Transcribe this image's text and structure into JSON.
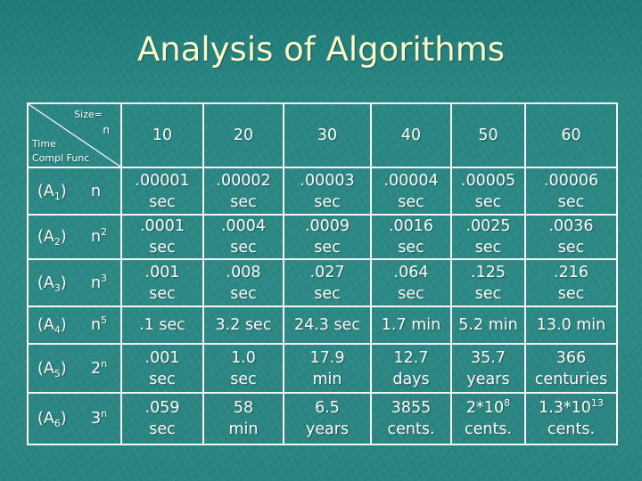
{
  "title": "Analysis of Algorithms",
  "corner": {
    "size_label": "Size=",
    "n_label": "n",
    "time_label": "Time",
    "func_label": "Compl Func"
  },
  "sizes": [
    "10",
    "20",
    "30",
    "40",
    "50",
    "60"
  ],
  "rows": [
    {
      "alg": "(A",
      "sub": "1",
      "alg_close": ")",
      "func_base": "n",
      "func_exp": "",
      "cells": [
        [
          ".00001",
          "sec"
        ],
        [
          ".00002",
          "sec"
        ],
        [
          ".00003",
          "sec"
        ],
        [
          ".00004",
          "sec"
        ],
        [
          ".00005",
          "sec"
        ],
        [
          ".00006",
          "sec"
        ]
      ]
    },
    {
      "alg": "(A",
      "sub": "2",
      "alg_close": ")",
      "func_base": "n",
      "func_exp": "2",
      "cells": [
        [
          ".0001",
          "sec"
        ],
        [
          ".0004",
          "sec"
        ],
        [
          ".0009",
          "sec"
        ],
        [
          ".0016",
          "sec"
        ],
        [
          ".0025",
          "sec"
        ],
        [
          ".0036",
          "sec"
        ]
      ]
    },
    {
      "alg": "(A",
      "sub": "3",
      "alg_close": ")",
      "func_base": "n",
      "func_exp": "3",
      "cells": [
        [
          ".001",
          "sec"
        ],
        [
          ".008",
          "sec"
        ],
        [
          ".027",
          "sec"
        ],
        [
          ".064",
          "sec"
        ],
        [
          ".125",
          "sec"
        ],
        [
          ".216",
          "sec"
        ]
      ]
    },
    {
      "alg": "(A",
      "sub": "4",
      "alg_close": ")",
      "func_base": "n",
      "func_exp": "5",
      "cells": [
        [
          ".1 sec"
        ],
        [
          "3.2 sec"
        ],
        [
          "24.3 sec"
        ],
        [
          "1.7 min"
        ],
        [
          "5.2 min"
        ],
        [
          "13.0 min"
        ]
      ]
    },
    {
      "alg": "(A",
      "sub": "5",
      "alg_close": ")",
      "func_base": "2",
      "func_exp": "n",
      "cells": [
        [
          ".001",
          "sec"
        ],
        [
          "1.0",
          "sec"
        ],
        [
          "17.9",
          "min"
        ],
        [
          "12.7",
          "days"
        ],
        [
          "35.7",
          "years"
        ],
        [
          "366",
          "centuries"
        ]
      ]
    },
    {
      "alg": "(A",
      "sub": "6",
      "alg_close": ")",
      "func_base": "3",
      "func_exp": "n",
      "cells": [
        [
          ".059",
          "sec"
        ],
        [
          "58",
          "min"
        ],
        [
          "6.5",
          "years"
        ],
        [
          "3855",
          "cents."
        ],
        [
          "2*10",
          "cents."
        ],
        [
          "1.3*10",
          "cents."
        ]
      ],
      "cell_exps": [
        "",
        "",
        "",
        "",
        "8",
        "13"
      ]
    }
  ]
}
